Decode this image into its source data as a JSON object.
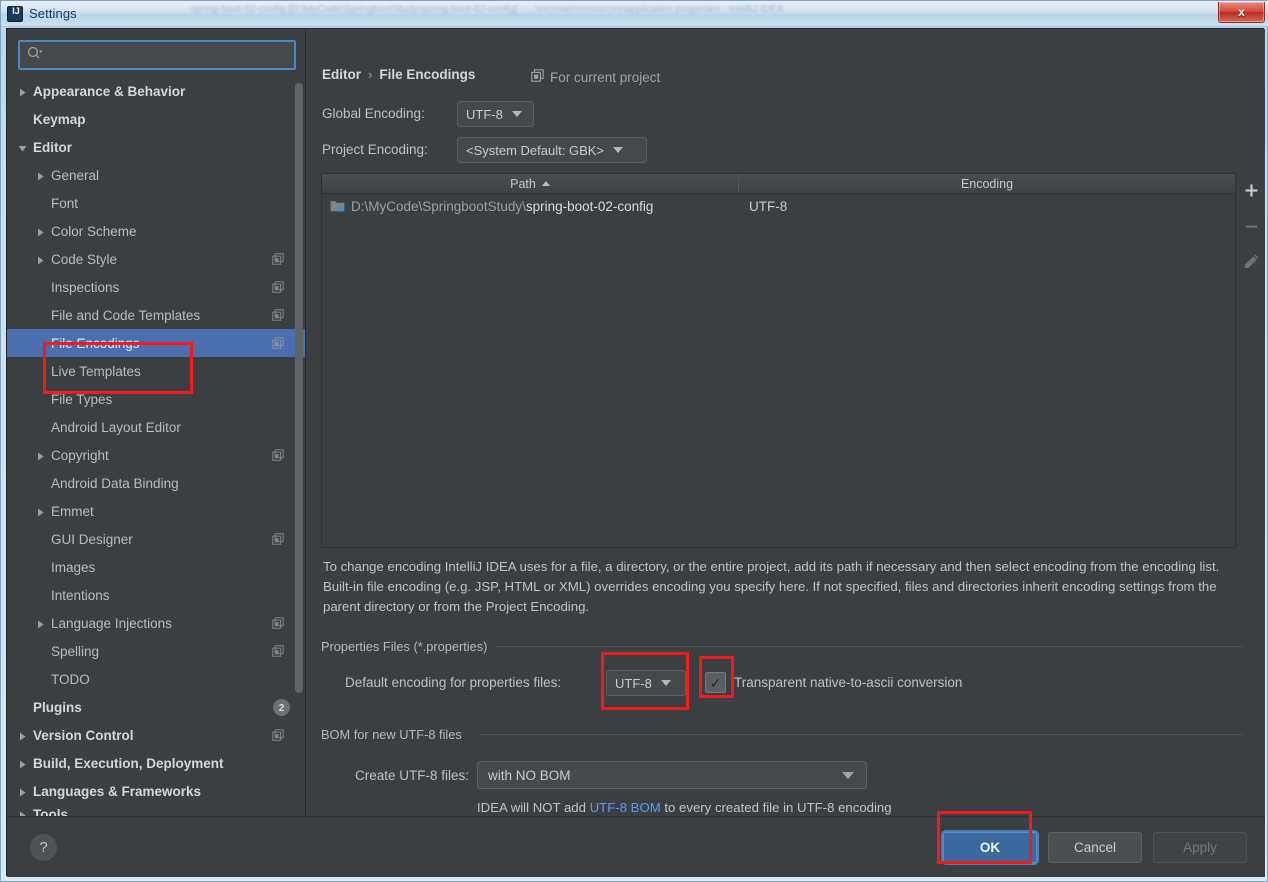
{
  "window": {
    "title": "Settings",
    "app_icon": "intellij-idea-icon",
    "close_label": "x",
    "ghost_title_text": "spring-boot-02-config [D:\\MyCode\\SpringbootStudy\\spring-boot-02-config] - ...\\src\\main\\resources\\application.properties - IntelliJ IDEA"
  },
  "sidebar": {
    "search": {
      "value": "",
      "placeholder": ""
    },
    "items": [
      {
        "label": "Appearance & Behavior",
        "level": 0,
        "arrow": "collapsed",
        "bold": true
      },
      {
        "label": "Keymap",
        "level": 0,
        "arrow": "none",
        "bold": true
      },
      {
        "label": "Editor",
        "level": 0,
        "arrow": "expanded",
        "bold": true
      },
      {
        "label": "General",
        "level": 1,
        "arrow": "collapsed"
      },
      {
        "label": "Font",
        "level": 1,
        "arrow": "none"
      },
      {
        "label": "Color Scheme",
        "level": 1,
        "arrow": "collapsed"
      },
      {
        "label": "Code Style",
        "level": 1,
        "arrow": "collapsed",
        "project_icon": true
      },
      {
        "label": "Inspections",
        "level": 1,
        "arrow": "none",
        "project_icon": true
      },
      {
        "label": "File and Code Templates",
        "level": 1,
        "arrow": "none",
        "project_icon": true
      },
      {
        "label": "File Encodings",
        "level": 1,
        "arrow": "none",
        "project_icon": true,
        "selected": true
      },
      {
        "label": "Live Templates",
        "level": 1,
        "arrow": "none"
      },
      {
        "label": "File Types",
        "level": 1,
        "arrow": "none"
      },
      {
        "label": "Android Layout Editor",
        "level": 1,
        "arrow": "none"
      },
      {
        "label": "Copyright",
        "level": 1,
        "arrow": "collapsed",
        "project_icon": true
      },
      {
        "label": "Android Data Binding",
        "level": 1,
        "arrow": "none"
      },
      {
        "label": "Emmet",
        "level": 1,
        "arrow": "collapsed"
      },
      {
        "label": "GUI Designer",
        "level": 1,
        "arrow": "none",
        "project_icon": true
      },
      {
        "label": "Images",
        "level": 1,
        "arrow": "none"
      },
      {
        "label": "Intentions",
        "level": 1,
        "arrow": "none"
      },
      {
        "label": "Language Injections",
        "level": 1,
        "arrow": "collapsed",
        "project_icon": true
      },
      {
        "label": "Spelling",
        "level": 1,
        "arrow": "none",
        "project_icon": true
      },
      {
        "label": "TODO",
        "level": 1,
        "arrow": "none"
      },
      {
        "label": "Plugins",
        "level": 0,
        "arrow": "none",
        "bold": true,
        "count": "2"
      },
      {
        "label": "Version Control",
        "level": 0,
        "arrow": "collapsed",
        "bold": true,
        "project_icon": true
      },
      {
        "label": "Build, Execution, Deployment",
        "level": 0,
        "arrow": "collapsed",
        "bold": true
      },
      {
        "label": "Languages & Frameworks",
        "level": 0,
        "arrow": "collapsed",
        "bold": true
      },
      {
        "label": "Tools",
        "level": 0,
        "arrow": "collapsed",
        "bold": true,
        "clipped": true
      }
    ]
  },
  "panel": {
    "breadcrumb": {
      "parent": "Editor",
      "separator": "›",
      "current": "File Encodings"
    },
    "for_current_project": "For current project",
    "global_encoding": {
      "label": "Global Encoding:",
      "value": "UTF-8"
    },
    "project_encoding": {
      "label": "Project Encoding:",
      "value": "<System Default: GBK>"
    },
    "table": {
      "columns": [
        "Path",
        "Encoding"
      ],
      "sort_column": "Path",
      "sort_direction": "ascending",
      "rows": [
        {
          "path_prefix": "D:\\MyCode\\SpringbootStudy\\",
          "path_name": "spring-boot-02-config",
          "encoding": "UTF-8"
        }
      ],
      "toolbar": [
        {
          "name": "add-path-button",
          "glyph": "+",
          "enabled": true
        },
        {
          "name": "remove-path-button",
          "glyph": "−",
          "enabled": false
        },
        {
          "name": "edit-path-button",
          "glyph": "pencil",
          "enabled": false
        }
      ]
    },
    "description": "To change encoding IntelliJ IDEA uses for a file, a directory, or the entire project, add its path if necessary and then select encoding from the encoding list. Built-in file encoding (e.g. JSP, HTML or XML) overrides encoding you specify here. If not specified, files and directories inherit encoding settings from the parent directory or from the Project Encoding.",
    "properties_group": {
      "title": "Properties Files (*.properties)",
      "default_encoding_label": "Default encoding for properties files:",
      "default_encoding_value": "UTF-8",
      "checkbox_label": "Transparent native-to-ascii conversion",
      "checkbox_checked": true,
      "checkbox_glyph": "✓"
    },
    "bom_group": {
      "title": "BOM for new UTF-8 files",
      "create_label": "Create UTF-8 files:",
      "create_value": "with NO BOM",
      "hint_before": "IDEA will NOT add ",
      "hint_link": "UTF-8 BOM",
      "hint_after": " to every created file in UTF-8 encoding"
    }
  },
  "bottom_bar": {
    "help_glyph": "?",
    "ok_label": "OK",
    "cancel_label": "Cancel",
    "apply_label": "Apply"
  },
  "colors": {
    "background": "#3c3f41",
    "selection": "#4b6eaf",
    "accent_blue": "#589df6",
    "annotation_red": "#f01c1c",
    "ok_button": "#39699e"
  }
}
